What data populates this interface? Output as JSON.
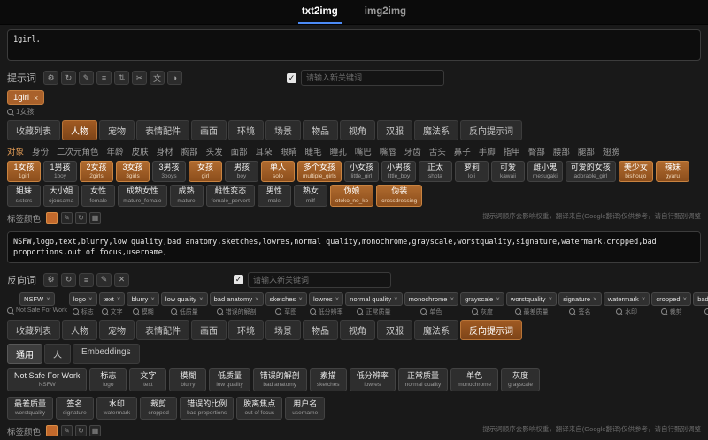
{
  "colors": {
    "accent_blue": "#4c8bf5",
    "tag_orange": "#a9612b",
    "active_tab_orange": "#9a5620"
  },
  "header": {
    "tabs": [
      {
        "label": "txt2img",
        "active": true
      },
      {
        "label": "img2img",
        "active": false
      }
    ]
  },
  "prompt": {
    "label": "提示词",
    "text": "1girl,",
    "toolbar_icons": [
      {
        "name": "gear",
        "glyph": "⚙"
      },
      {
        "name": "refresh",
        "glyph": "↻"
      },
      {
        "name": "edit",
        "glyph": "✎"
      },
      {
        "name": "list",
        "glyph": "≡"
      },
      {
        "name": "sort",
        "glyph": "⇅"
      },
      {
        "name": "cut",
        "glyph": "✂"
      },
      {
        "name": "translate",
        "glyph": "文"
      },
      {
        "name": "theme",
        "glyph": "◑"
      }
    ],
    "checkbox_mark": "✓",
    "keyword_placeholder": "请输入新关键词",
    "chips": [
      {
        "en": "1girl",
        "zh": "1女孩"
      }
    ]
  },
  "category_tabs": [
    {
      "label": "收藏列表"
    },
    {
      "label": "人物",
      "active": true
    },
    {
      "label": "宠物"
    },
    {
      "label": "表情配件"
    },
    {
      "label": "画面"
    },
    {
      "label": "环境"
    },
    {
      "label": "场景"
    },
    {
      "label": "物品"
    },
    {
      "label": "视角"
    },
    {
      "label": "双服"
    },
    {
      "label": "魔法系"
    },
    {
      "label": "反向提示词"
    }
  ],
  "subcategories": [
    {
      "label": "对象",
      "active": true
    },
    {
      "label": "身份"
    },
    {
      "label": "二次元角色"
    },
    {
      "label": "年龄"
    },
    {
      "label": "皮肤"
    },
    {
      "label": "身材"
    },
    {
      "label": "胸部"
    },
    {
      "label": "头发"
    },
    {
      "label": "面部"
    },
    {
      "label": "耳朵"
    },
    {
      "label": "眼睛"
    },
    {
      "label": "睫毛"
    },
    {
      "label": "瞳孔"
    },
    {
      "label": "嘴巴"
    },
    {
      "label": "嘴唇"
    },
    {
      "label": "牙齿"
    },
    {
      "label": "舌头"
    },
    {
      "label": "鼻子"
    },
    {
      "label": "手脚"
    },
    {
      "label": "指甲"
    },
    {
      "label": "臀部"
    },
    {
      "label": "腰部"
    },
    {
      "label": "腿部"
    },
    {
      "label": "翅膀"
    }
  ],
  "tag_grid": [
    {
      "zh": "1女孩",
      "en": "1girl",
      "selected": true
    },
    {
      "zh": "1男孩",
      "en": "1boy"
    },
    {
      "zh": "2女孩",
      "en": "2girls",
      "selected": true
    },
    {
      "zh": "3女孩",
      "en": "3girls",
      "selected": true
    },
    {
      "zh": "3男孩",
      "en": "3boys"
    },
    {
      "zh": "女孩",
      "en": "girl",
      "selected": true
    },
    {
      "zh": "男孩",
      "en": "boy"
    },
    {
      "zh": "单人",
      "en": "solo",
      "selected": true
    },
    {
      "zh": "多个女孩",
      "en": "multiple_girls",
      "selected": true
    },
    {
      "zh": "小女孩",
      "en": "little_girl"
    },
    {
      "zh": "小男孩",
      "en": "little_boy"
    },
    {
      "zh": "正太",
      "en": "shota"
    },
    {
      "zh": "萝莉",
      "en": "loli"
    },
    {
      "zh": "可爱",
      "en": "kawaii"
    },
    {
      "zh": "雌小鬼",
      "en": "mesugaki"
    },
    {
      "zh": "可爱的女孩",
      "en": "adorable_girl"
    },
    {
      "zh": "美少女",
      "en": "bishoujo",
      "selected": true
    },
    {
      "zh": "辣妹",
      "en": "gyaru",
      "selected": true
    },
    {
      "zh": "姐妹",
      "en": "sisters"
    },
    {
      "zh": "大小姐",
      "en": "ojousama"
    },
    {
      "zh": "女性",
      "en": "female"
    },
    {
      "zh": "成熟女性",
      "en": "mature_female"
    },
    {
      "zh": "成熟",
      "en": "mature"
    },
    {
      "zh": "雌性变态",
      "en": "female_pervert"
    },
    {
      "zh": "男性",
      "en": "male"
    },
    {
      "zh": "熟女",
      "en": "milf"
    },
    {
      "zh": "伪娘",
      "en": "otoko_no_ko",
      "selected": true
    },
    {
      "zh": "伪装",
      "en": "crossdressing",
      "selected": true
    }
  ],
  "tag_color": {
    "label": "标签颜色",
    "buttons": [
      {
        "name": "edit",
        "glyph": "✎"
      },
      {
        "name": "refresh",
        "glyph": "↻"
      },
      {
        "name": "grid",
        "glyph": "▦"
      }
    ]
  },
  "hints": {
    "top": "提示词顺序会影响权重，翻译来自(Google翻译)仅供参考，请自行甄别调整",
    "bottom": "提示词顺序会影响权重，翻译来自(Google翻译)仅供参考，请自行甄别调整"
  },
  "negative": {
    "label": "反向词",
    "text": "NSFW,logo,text,blurry,low quality,bad anatomy,sketches,lowres,normal quality,monochrome,grayscale,worstquality,signature,watermark,cropped,bad proportions,out of focus,username,",
    "toolbar_icons": [
      {
        "name": "gear",
        "glyph": "⚙"
      },
      {
        "name": "refresh",
        "glyph": "↻"
      },
      {
        "name": "list",
        "glyph": "≡"
      },
      {
        "name": "edit",
        "glyph": "✎"
      },
      {
        "name": "clear",
        "glyph": "✕"
      }
    ],
    "checkbox_mark": "✓",
    "keyword_placeholder": "请输入新关键词",
    "chips": [
      {
        "en": "NSFW",
        "zh": "Not Safe For Work"
      },
      {
        "en": "logo",
        "zh": "标志"
      },
      {
        "en": "text",
        "zh": "文字"
      },
      {
        "en": "blurry",
        "zh": "模糊"
      },
      {
        "en": "low quality",
        "zh": "低质量"
      },
      {
        "en": "bad anatomy",
        "zh": "错误的解剖"
      },
      {
        "en": "sketches",
        "zh": "草图"
      },
      {
        "en": "lowres",
        "zh": "低分辨率"
      },
      {
        "en": "normal quality",
        "zh": "正常质量"
      },
      {
        "en": "monochrome",
        "zh": "单色"
      },
      {
        "en": "grayscale",
        "zh": "灰度"
      },
      {
        "en": "worstquality",
        "zh": "最差质量"
      },
      {
        "en": "signature",
        "zh": "签名"
      },
      {
        "en": "watermark",
        "zh": "水印"
      },
      {
        "en": "cropped",
        "zh": "裁剪"
      },
      {
        "en": "bad proportions",
        "zh": "错误的比例"
      },
      {
        "en": "out of focus",
        "zh": "脱离焦点"
      },
      {
        "en": "username",
        "zh": "用户名"
      }
    ]
  },
  "bottom_tabs": [
    {
      "label": "收藏列表"
    },
    {
      "label": "人物"
    },
    {
      "label": "宠物"
    },
    {
      "label": "表情配件"
    },
    {
      "label": "画面"
    },
    {
      "label": "环境"
    },
    {
      "label": "场景"
    },
    {
      "label": "物品"
    },
    {
      "label": "视角"
    },
    {
      "label": "双服"
    },
    {
      "label": "魔法系"
    },
    {
      "label": "反向提示词",
      "active": true
    }
  ],
  "neg_subtabs": [
    {
      "label": "通用",
      "active": true
    },
    {
      "label": "人"
    },
    {
      "label": "Embeddings"
    }
  ],
  "neg_grid": {
    "row1": [
      {
        "zh": "Not Safe For Work",
        "en": "NSFW"
      },
      {
        "zh": "标志",
        "en": "logo"
      },
      {
        "zh": "文字",
        "en": "text"
      },
      {
        "zh": "模糊",
        "en": "blurry"
      },
      {
        "zh": "低质量",
        "en": "low quality"
      },
      {
        "zh": "错误的解剖",
        "en": "bad anatomy"
      },
      {
        "zh": "素描",
        "en": "sketches"
      },
      {
        "zh": "低分辨率",
        "en": "lowres"
      },
      {
        "zh": "正常质量",
        "en": "normal quality"
      },
      {
        "zh": "单色",
        "en": "monochrome"
      },
      {
        "zh": "灰度",
        "en": "grayscale"
      }
    ],
    "row2": [
      {
        "zh": "最差质量",
        "en": "worstquality"
      },
      {
        "zh": "签名",
        "en": "signature"
      },
      {
        "zh": "水印",
        "en": "watermark"
      },
      {
        "zh": "裁剪",
        "en": "cropped"
      },
      {
        "zh": "错误的比例",
        "en": "bad proportions"
      },
      {
        "zh": "脱离焦点",
        "en": "out of focus"
      },
      {
        "zh": "用户名",
        "en": "username"
      }
    ]
  },
  "bottom_tag_color": {
    "label": "标签颜色",
    "buttons": [
      {
        "name": "edit",
        "glyph": "✎"
      },
      {
        "name": "refresh",
        "glyph": "↻"
      },
      {
        "name": "grid",
        "glyph": "▦"
      }
    ]
  }
}
